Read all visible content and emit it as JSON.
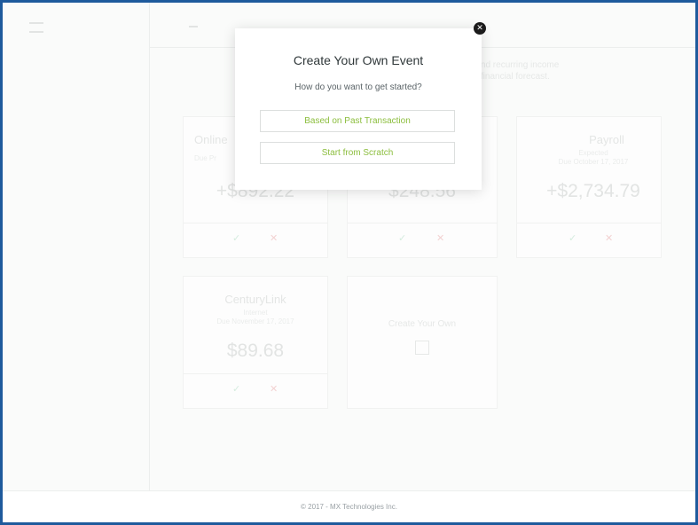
{
  "background": {
    "intro_lines": [
      "e bills and recurring income",
      "er your financial forecast."
    ],
    "cards": [
      {
        "name": "Online",
        "sub_lines": [
          "",
          "Due Pr"
        ],
        "amount": "+$892.22"
      },
      {
        "name": "",
        "sub_lines": [
          "",
          ""
        ],
        "amount": "$248.56"
      },
      {
        "name": "Payroll",
        "sub_lines": [
          "Expected",
          "Due October 17, 2017"
        ],
        "amount": "+$2,734.79"
      },
      {
        "name": "CenturyLink",
        "sub_lines": [
          "Internet",
          "Due November 17, 2017"
        ],
        "amount": "$89.68"
      }
    ],
    "create_card_label": "Create Your Own",
    "accept_icon": "✓",
    "reject_icon": "✕"
  },
  "modal": {
    "title": "Create Your Own Event",
    "question": "How do you want to get started?",
    "button_past": "Based on Past Transaction",
    "button_scratch": "Start from Scratch",
    "close_icon": "✕"
  },
  "footer": {
    "copyright": "© 2017 - MX Technologies Inc."
  },
  "colors": {
    "frame_border": "#1e5a9c",
    "accent": "#8cbe3e",
    "close_button": "#1b1b1b"
  }
}
